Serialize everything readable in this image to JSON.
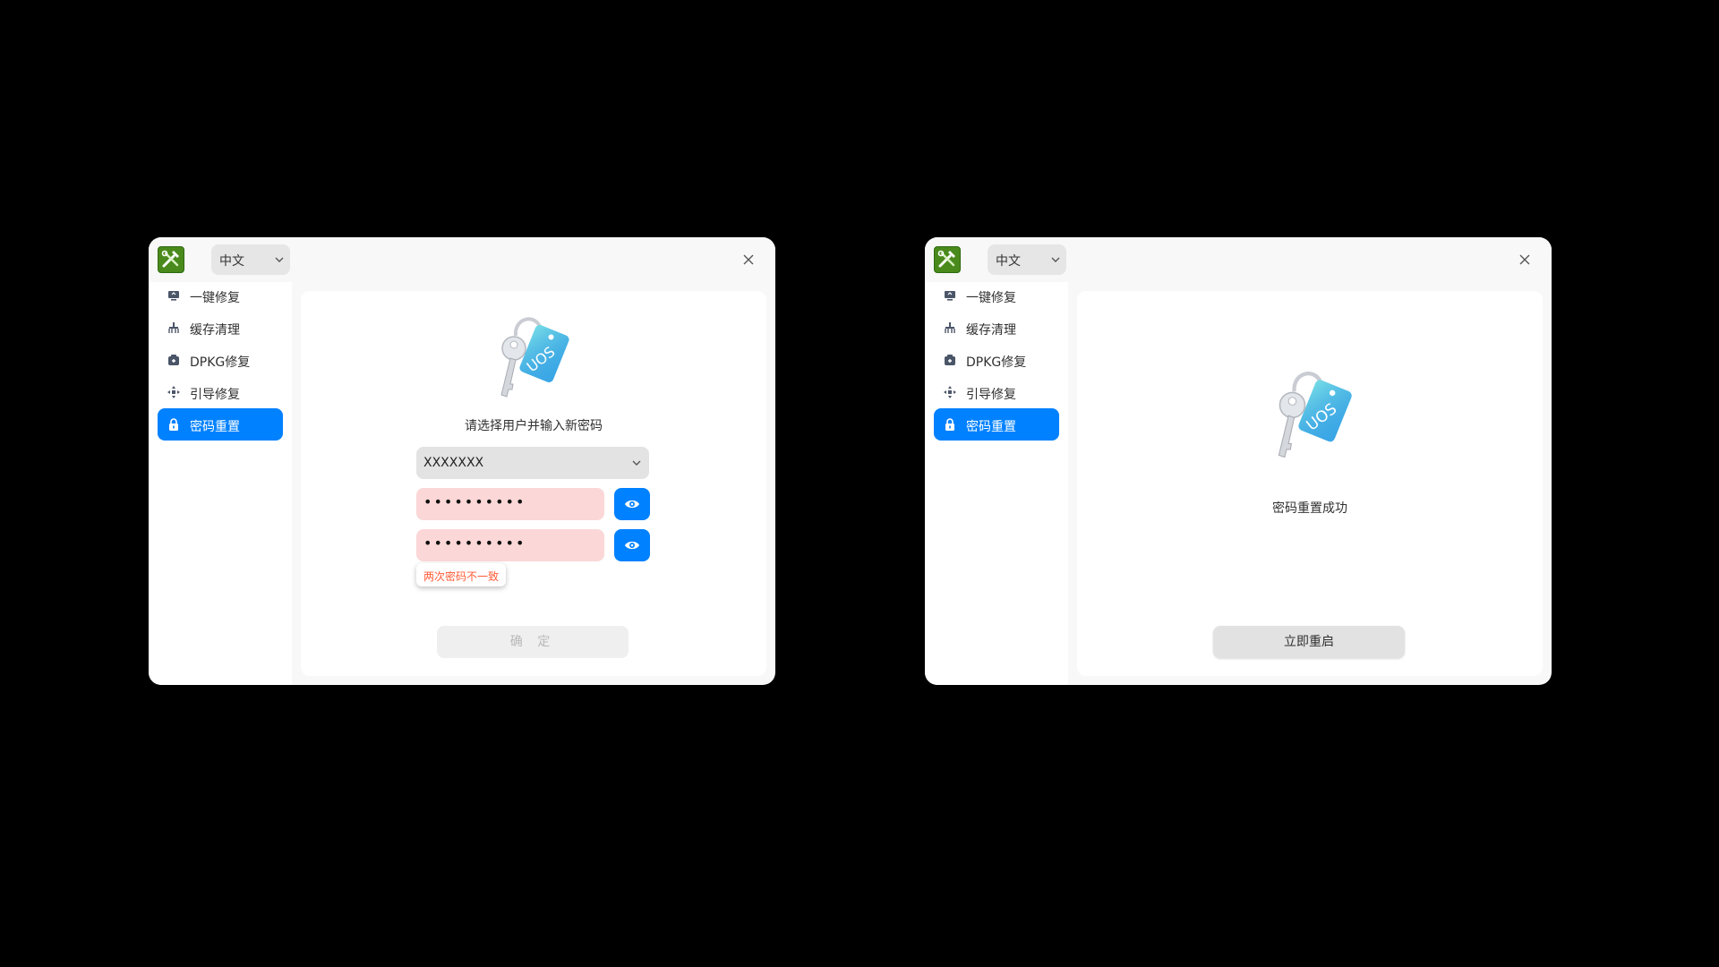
{
  "colors": {
    "accent": "#0081ff",
    "error_bg": "#fbd7d7",
    "error_text": "#ff5a36"
  },
  "left_window": {
    "language": "中文",
    "sidebar": {
      "items": [
        {
          "label": "一键修复",
          "icon": "monitor-repair-icon"
        },
        {
          "label": "缓存清理",
          "icon": "broom-icon"
        },
        {
          "label": "DPKG修复",
          "icon": "package-icon"
        },
        {
          "label": "引导修复",
          "icon": "move-icon"
        },
        {
          "label": "密码重置",
          "icon": "lock-icon",
          "active": true
        }
      ]
    },
    "content": {
      "prompt": "请选择用户并输入新密码",
      "user_select": "XXXXXXX",
      "password1": "••••••••••",
      "password2": "••••••••••",
      "error_tooltip": "两次密码不一致",
      "confirm_label": "确 定"
    }
  },
  "right_window": {
    "language": "中文",
    "sidebar": {
      "items": [
        {
          "label": "一键修复",
          "icon": "monitor-repair-icon"
        },
        {
          "label": "缓存清理",
          "icon": "broom-icon"
        },
        {
          "label": "DPKG修复",
          "icon": "package-icon"
        },
        {
          "label": "引导修复",
          "icon": "move-icon"
        },
        {
          "label": "密码重置",
          "icon": "lock-icon",
          "active": true
        }
      ]
    },
    "content": {
      "success_text": "密码重置成功",
      "reboot_label": "立即重启"
    }
  }
}
